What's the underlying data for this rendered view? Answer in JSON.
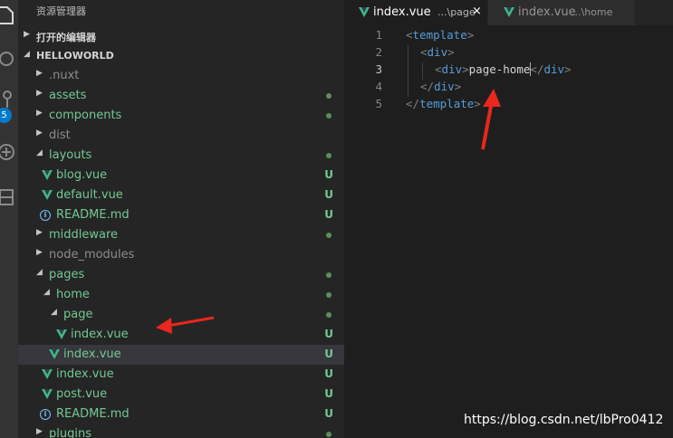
{
  "explorer": {
    "title": "资源管理器",
    "open_editors": "打开的编辑器",
    "project": "HELLOWORLD",
    "items": [
      {
        "label": ".nuxt",
        "status": ""
      },
      {
        "label": "assets",
        "status": ""
      },
      {
        "label": "components",
        "status": ""
      },
      {
        "label": "dist",
        "status": ""
      },
      {
        "label": "layouts",
        "status": ""
      },
      {
        "label": "blog.vue",
        "status": "U"
      },
      {
        "label": "default.vue",
        "status": "U"
      },
      {
        "label": "README.md",
        "status": "U"
      },
      {
        "label": "middleware",
        "status": ""
      },
      {
        "label": "node_modules",
        "status": ""
      },
      {
        "label": "pages",
        "status": ""
      },
      {
        "label": "home",
        "status": ""
      },
      {
        "label": "page",
        "status": ""
      },
      {
        "label": "index.vue",
        "status": "U"
      },
      {
        "label": "index.vue",
        "status": "U"
      },
      {
        "label": "index.vue",
        "status": "U"
      },
      {
        "label": "post.vue",
        "status": "U"
      },
      {
        "label": "README.md",
        "status": "U"
      },
      {
        "label": "plugins",
        "status": ""
      }
    ]
  },
  "activity": {
    "badge": "5"
  },
  "tabs": [
    {
      "name": "index.vue",
      "desc": "...\\page",
      "close": "×"
    },
    {
      "name": "index.vue",
      "desc": "...\\home"
    }
  ],
  "editor": {
    "line_numbers": [
      "1",
      "2",
      "3",
      "4",
      "5"
    ],
    "line1": {
      "open": "<",
      "tag": "template",
      "close": ">"
    },
    "line2": {
      "open": "<",
      "tag": "div",
      "close": ">"
    },
    "line3": {
      "open1": "<",
      "tag1": "div",
      "close1": ">",
      "text": "page-home",
      "open2": "</",
      "tag2": "div",
      "close2": ">"
    },
    "line4": {
      "open": "</",
      "tag": "div",
      "close": ">"
    },
    "line5": {
      "open": "</",
      "tag": "template",
      "close": ">"
    }
  },
  "watermark": "https://blog.csdn.net/lbPro0412",
  "colors": {
    "accent": "#007acc",
    "vue_green": "#41b883",
    "untracked": "#73c991",
    "annotation_arrow": "#e8271e"
  }
}
